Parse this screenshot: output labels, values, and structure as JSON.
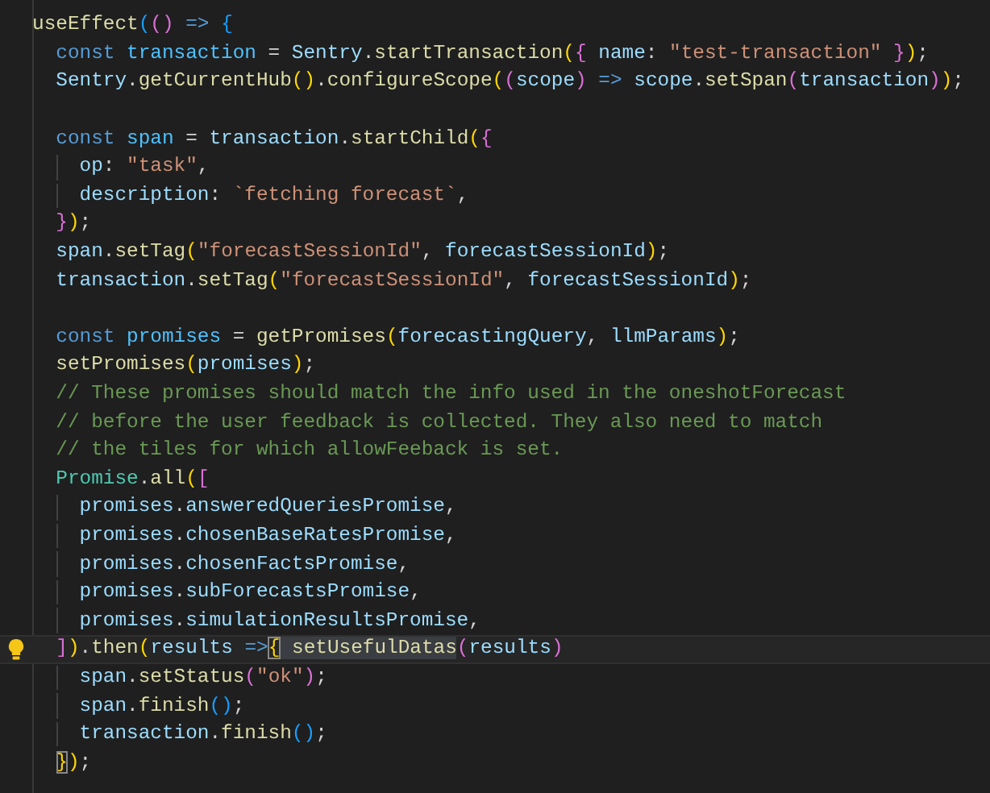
{
  "editor": {
    "lines": [
      {
        "active": false,
        "tokens": [
          {
            "kind": "fn",
            "text": "useEffect"
          },
          {
            "kind": "b3",
            "text": "("
          },
          {
            "kind": "b2",
            "text": "()"
          },
          {
            "kind": "kw",
            "text": " => "
          },
          {
            "kind": "b3",
            "text": "{"
          }
        ],
        "children": [
          {
            "active": false,
            "tokens": [
              {
                "kind": "kw",
                "text": "const "
              },
              {
                "kind": "cv",
                "text": "transaction"
              },
              {
                "kind": "p",
                "text": " = "
              },
              {
                "kind": "var",
                "text": "Sentry"
              },
              {
                "kind": "p",
                "text": "."
              },
              {
                "kind": "fn",
                "text": "startTransaction"
              },
              {
                "kind": "b1",
                "text": "("
              },
              {
                "kind": "b2",
                "text": "{ "
              },
              {
                "kind": "var",
                "text": "name"
              },
              {
                "kind": "p",
                "text": ": "
              },
              {
                "kind": "str",
                "text": "\"test-transaction\""
              },
              {
                "kind": "b2",
                "text": " }"
              },
              {
                "kind": "b1",
                "text": ")"
              },
              {
                "kind": "p",
                "text": ";"
              }
            ]
          },
          {
            "active": false,
            "tokens": [
              {
                "kind": "var",
                "text": "Sentry"
              },
              {
                "kind": "p",
                "text": "."
              },
              {
                "kind": "fn",
                "text": "getCurrentHub"
              },
              {
                "kind": "b1",
                "text": "()"
              },
              {
                "kind": "p",
                "text": "."
              },
              {
                "kind": "fn",
                "text": "configureScope"
              },
              {
                "kind": "b1",
                "text": "("
              },
              {
                "kind": "b2",
                "text": "("
              },
              {
                "kind": "var",
                "text": "scope"
              },
              {
                "kind": "b2",
                "text": ")"
              },
              {
                "kind": "kw",
                "text": " => "
              },
              {
                "kind": "var",
                "text": "scope"
              },
              {
                "kind": "p",
                "text": "."
              },
              {
                "kind": "fn",
                "text": "setSpan"
              },
              {
                "kind": "b2",
                "text": "("
              },
              {
                "kind": "var",
                "text": "transaction"
              },
              {
                "kind": "b2",
                "text": ")"
              },
              {
                "kind": "b1",
                "text": ")"
              },
              {
                "kind": "p",
                "text": ";"
              }
            ]
          },
          {
            "active": false
          },
          {
            "active": false,
            "tokens": [
              {
                "kind": "kw",
                "text": "const "
              },
              {
                "kind": "cv",
                "text": "span"
              },
              {
                "kind": "p",
                "text": " = "
              },
              {
                "kind": "var",
                "text": "transaction"
              },
              {
                "kind": "p",
                "text": "."
              },
              {
                "kind": "fn",
                "text": "startChild"
              },
              {
                "kind": "b1",
                "text": "("
              },
              {
                "kind": "b2",
                "text": "{"
              }
            ],
            "children": [
              {
                "active": false,
                "tokens": [
                  {
                    "kind": "var",
                    "text": "op"
                  },
                  {
                    "kind": "p",
                    "text": ": "
                  },
                  {
                    "kind": "str",
                    "text": "\"task\""
                  },
                  {
                    "kind": "p",
                    "text": ","
                  }
                ]
              },
              {
                "active": false,
                "tokens": [
                  {
                    "kind": "var",
                    "text": "description"
                  },
                  {
                    "kind": "p",
                    "text": ": "
                  },
                  {
                    "kind": "str",
                    "text": "`fetching forecast`"
                  },
                  {
                    "kind": "p",
                    "text": ","
                  }
                ]
              }
            ]
          },
          {
            "active": false,
            "tokens": [
              {
                "kind": "b2",
                "text": "}"
              },
              {
                "kind": "b1",
                "text": ")"
              },
              {
                "kind": "p",
                "text": ";"
              }
            ]
          },
          {
            "active": false,
            "tokens": [
              {
                "kind": "var",
                "text": "span"
              },
              {
                "kind": "p",
                "text": "."
              },
              {
                "kind": "fn",
                "text": "setTag"
              },
              {
                "kind": "b1",
                "text": "("
              },
              {
                "kind": "str",
                "text": "\"forecastSessionId\""
              },
              {
                "kind": "p",
                "text": ", "
              },
              {
                "kind": "var",
                "text": "forecastSessionId"
              },
              {
                "kind": "b1",
                "text": ")"
              },
              {
                "kind": "p",
                "text": ";"
              }
            ]
          },
          {
            "active": false,
            "tokens": [
              {
                "kind": "var",
                "text": "transaction"
              },
              {
                "kind": "p",
                "text": "."
              },
              {
                "kind": "fn",
                "text": "setTag"
              },
              {
                "kind": "b1",
                "text": "("
              },
              {
                "kind": "str",
                "text": "\"forecastSessionId\""
              },
              {
                "kind": "p",
                "text": ", "
              },
              {
                "kind": "var",
                "text": "forecastSessionId"
              },
              {
                "kind": "b1",
                "text": ")"
              },
              {
                "kind": "p",
                "text": ";"
              }
            ]
          },
          {
            "active": false
          },
          {
            "active": false,
            "tokens": [
              {
                "kind": "kw",
                "text": "const "
              },
              {
                "kind": "cv",
                "text": "promises"
              },
              {
                "kind": "p",
                "text": " = "
              },
              {
                "kind": "fn",
                "text": "getPromises"
              },
              {
                "kind": "b1",
                "text": "("
              },
              {
                "kind": "var",
                "text": "forecastingQuery"
              },
              {
                "kind": "p",
                "text": ", "
              },
              {
                "kind": "var",
                "text": "llmParams"
              },
              {
                "kind": "b1",
                "text": ")"
              },
              {
                "kind": "p",
                "text": ";"
              }
            ]
          },
          {
            "active": false,
            "tokens": [
              {
                "kind": "fn",
                "text": "setPromises"
              },
              {
                "kind": "b1",
                "text": "("
              },
              {
                "kind": "var",
                "text": "promises"
              },
              {
                "kind": "b1",
                "text": ")"
              },
              {
                "kind": "p",
                "text": ";"
              }
            ]
          },
          {
            "active": false,
            "tokens": [
              {
                "kind": "com",
                "text": "// These promises should match the info used in the oneshotForecast"
              }
            ]
          },
          {
            "active": false,
            "tokens": [
              {
                "kind": "com",
                "text": "// before the user feedback is collected. They also need to match"
              }
            ]
          },
          {
            "active": false,
            "tokens": [
              {
                "kind": "com",
                "text": "// the tiles for which allowFeeback is set."
              }
            ]
          },
          {
            "active": false,
            "tokens": [
              {
                "kind": "cls",
                "text": "Promise"
              },
              {
                "kind": "p",
                "text": "."
              },
              {
                "kind": "fn",
                "text": "all"
              },
              {
                "kind": "b1",
                "text": "("
              },
              {
                "kind": "b2",
                "text": "["
              }
            ],
            "children": [
              {
                "active": false,
                "tokens": [
                  {
                    "kind": "var",
                    "text": "promises"
                  },
                  {
                    "kind": "p",
                    "text": "."
                  },
                  {
                    "kind": "var",
                    "text": "answeredQueriesPromise"
                  },
                  {
                    "kind": "p",
                    "text": ","
                  }
                ]
              },
              {
                "active": false,
                "tokens": [
                  {
                    "kind": "var",
                    "text": "promises"
                  },
                  {
                    "kind": "p",
                    "text": "."
                  },
                  {
                    "kind": "var",
                    "text": "chosenBaseRatesPromise"
                  },
                  {
                    "kind": "p",
                    "text": ","
                  }
                ]
              },
              {
                "active": false,
                "tokens": [
                  {
                    "kind": "var",
                    "text": "promises"
                  },
                  {
                    "kind": "p",
                    "text": "."
                  },
                  {
                    "kind": "var",
                    "text": "chosenFactsPromise"
                  },
                  {
                    "kind": "p",
                    "text": ","
                  }
                ]
              },
              {
                "active": false,
                "tokens": [
                  {
                    "kind": "var",
                    "text": "promises"
                  },
                  {
                    "kind": "p",
                    "text": "."
                  },
                  {
                    "kind": "var",
                    "text": "subForecastsPromise"
                  },
                  {
                    "kind": "p",
                    "text": ","
                  }
                ]
              },
              {
                "active": false,
                "tokens": [
                  {
                    "kind": "var",
                    "text": "promises"
                  },
                  {
                    "kind": "p",
                    "text": "."
                  },
                  {
                    "kind": "var",
                    "text": "simulationResultsPromise"
                  },
                  {
                    "kind": "p",
                    "text": ","
                  }
                ]
              }
            ]
          },
          {
            "active": true,
            "tokens": [
              {
                "kind": "b2",
                "text": "]"
              },
              {
                "kind": "b1",
                "text": ")"
              },
              {
                "kind": "p",
                "text": "."
              },
              {
                "kind": "fn",
                "text": "then"
              },
              {
                "kind": "b1",
                "text": "("
              },
              {
                "kind": "var",
                "text": "results "
              },
              {
                "kind": "kw",
                "text": "=>"
              },
              {
                "kind": "bm",
                "text": "{"
              },
              {
                "kind": "hl",
                "text": " setUsefulDatas"
              },
              {
                "kind": "b2",
                "text": "("
              },
              {
                "kind": "var",
                "text": "results"
              },
              {
                "kind": "b2",
                "text": ")"
              }
            ],
            "children": [
              {
                "active": false,
                "tokens": [
                  {
                    "kind": "var",
                    "text": "span"
                  },
                  {
                    "kind": "p",
                    "text": "."
                  },
                  {
                    "kind": "fn",
                    "text": "setStatus"
                  },
                  {
                    "kind": "b2",
                    "text": "("
                  },
                  {
                    "kind": "str",
                    "text": "\"ok\""
                  },
                  {
                    "kind": "b2",
                    "text": ")"
                  },
                  {
                    "kind": "p",
                    "text": ";"
                  }
                ]
              },
              {
                "active": false,
                "tokens": [
                  {
                    "kind": "var",
                    "text": "span"
                  },
                  {
                    "kind": "p",
                    "text": "."
                  },
                  {
                    "kind": "fn",
                    "text": "finish"
                  },
                  {
                    "kind": "b3",
                    "text": "()"
                  },
                  {
                    "kind": "p",
                    "text": ";"
                  }
                ]
              },
              {
                "active": false,
                "tokens": [
                  {
                    "kind": "var",
                    "text": "transaction"
                  },
                  {
                    "kind": "p",
                    "text": "."
                  },
                  {
                    "kind": "fn",
                    "text": "finish"
                  },
                  {
                    "kind": "b3",
                    "text": "()"
                  },
                  {
                    "kind": "p",
                    "text": ";"
                  }
                ]
              }
            ]
          },
          {
            "active": false,
            "tokens": [
              {
                "kind": "bm",
                "text": "}"
              },
              {
                "kind": "b1",
                "text": ")"
              },
              {
                "kind": "p",
                "text": ";"
              }
            ]
          }
        ]
      }
    ]
  }
}
